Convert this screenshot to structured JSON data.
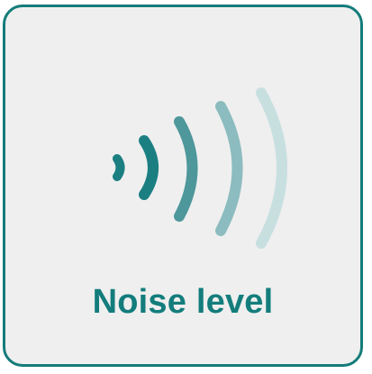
{
  "tile": {
    "label": "Noise level",
    "icon": "sound-waves-icon",
    "colors": {
      "border": "#147c7a",
      "background": "#efefef",
      "label": "#137d7c",
      "wave_1": "#1b7f82",
      "wave_2": "#4e979b",
      "wave_3": "#8cbcbf",
      "wave_4": "#c8dfe0"
    }
  }
}
